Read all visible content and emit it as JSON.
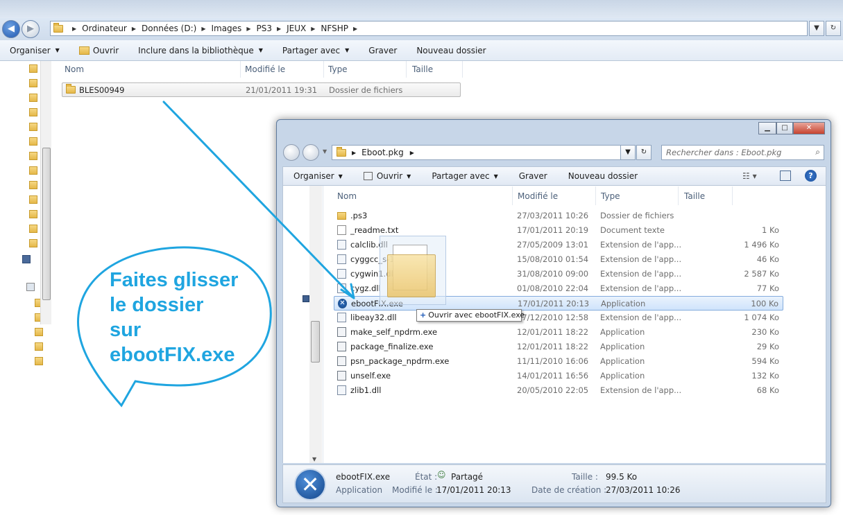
{
  "background_explorer": {
    "breadcrumb": [
      "Ordinateur",
      "Données (D:)",
      "Images",
      "PS3",
      "JEUX",
      "NFSHP"
    ],
    "toolbar": {
      "organiser": "Organiser",
      "ouvrir": "Ouvrir",
      "inclure": "Inclure dans la bibliothèque",
      "partager": "Partager avec",
      "graver": "Graver",
      "nouveau_dossier": "Nouveau dossier"
    },
    "columns": {
      "nom": "Nom",
      "modifie": "Modifié le",
      "type": "Type",
      "taille": "Taille"
    },
    "row": {
      "name": "BLES00949",
      "date": "21/01/2011 19:31",
      "type": "Dossier de fichiers"
    }
  },
  "foreground_explorer": {
    "address": "Eboot.pkg",
    "search_placeholder": "Rechercher dans : Eboot.pkg",
    "toolbar": {
      "organiser": "Organiser",
      "ouvrir": "Ouvrir",
      "partager": "Partager avec",
      "graver": "Graver",
      "nouveau_dossier": "Nouveau dossier"
    },
    "columns": {
      "nom": "Nom",
      "modifie": "Modifié le",
      "type": "Type",
      "taille": "Taille"
    },
    "files": [
      {
        "name": ".ps3",
        "date": "27/03/2011 10:26",
        "type": "Dossier de fichiers",
        "size": "",
        "icon": "folder"
      },
      {
        "name": "_readme.txt",
        "date": "17/01/2011 20:19",
        "type": "Document texte",
        "size": "1 Ko",
        "icon": "txt"
      },
      {
        "name": "calclib.dll",
        "date": "27/05/2009 13:01",
        "type": "Extension de l'app...",
        "size": "1 496 Ko",
        "icon": "dll"
      },
      {
        "name": "cyggcc_s-1.dll",
        "date": "15/08/2010 01:54",
        "type": "Extension de l'app...",
        "size": "46 Ko",
        "icon": "dll"
      },
      {
        "name": "cygwin1.dll",
        "date": "31/08/2010 09:00",
        "type": "Extension de l'app...",
        "size": "2 587 Ko",
        "icon": "dll"
      },
      {
        "name": "cygz.dll",
        "date": "01/08/2010 22:04",
        "type": "Extension de l'app...",
        "size": "77 Ko",
        "icon": "dll"
      },
      {
        "name": "ebootFIX.exe",
        "date": "17/01/2011 20:13",
        "type": "Application",
        "size": "100 Ko",
        "icon": "xico"
      },
      {
        "name": "libeay32.dll",
        "date": "17/12/2010 12:58",
        "type": "Extension de l'app...",
        "size": "1 074 Ko",
        "icon": "dll"
      },
      {
        "name": "make_self_npdrm.exe",
        "date": "12/01/2011 18:22",
        "type": "Application",
        "size": "230 Ko",
        "icon": "app"
      },
      {
        "name": "package_finalize.exe",
        "date": "12/01/2011 18:22",
        "type": "Application",
        "size": "29 Ko",
        "icon": "app"
      },
      {
        "name": "psn_package_npdrm.exe",
        "date": "11/11/2010 16:06",
        "type": "Application",
        "size": "594 Ko",
        "icon": "app"
      },
      {
        "name": "unself.exe",
        "date": "14/01/2011 16:56",
        "type": "Application",
        "size": "132 Ko",
        "icon": "app"
      },
      {
        "name": "zlib1.dll",
        "date": "20/05/2010 22:05",
        "type": "Extension de l'app...",
        "size": "68 Ko",
        "icon": "dll"
      }
    ],
    "selected_index": 6,
    "status": {
      "name": "ebootFIX.exe",
      "kind": "Application",
      "etat_label": "État :",
      "etat_value": "Partagé",
      "modifie_label": "Modifié le :",
      "modifie_value": "17/01/2011 20:13",
      "taille_label": "Taille :",
      "taille_value": "99.5 Ko",
      "creation_label": "Date de création :",
      "creation_value": "27/03/2011 10:26"
    }
  },
  "drag_tooltip": "Ouvrir avec ebootFIX.exe",
  "annotation": {
    "lines": [
      "Faites glisser",
      "le dossier",
      "sur",
      "ebootFIX.exe"
    ],
    "color": "#1fa5e0"
  }
}
